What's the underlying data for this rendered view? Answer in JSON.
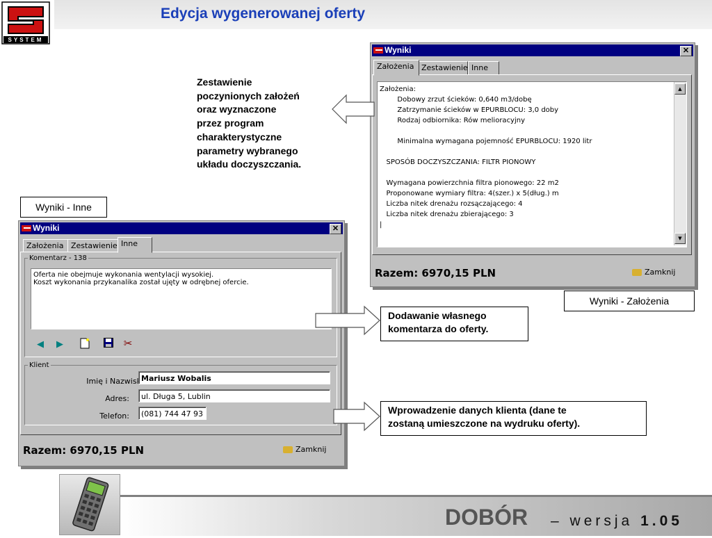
{
  "slide": {
    "title": "Edycja wygenerowanej oferty",
    "logo_text": "SYSTEM"
  },
  "window_zalozenia": {
    "title": "Wyniki",
    "close_glyph": "✕",
    "tabs": [
      "Założenia",
      "Zestawienie",
      "Inne"
    ],
    "active_tab": "Założenia",
    "content_lines": [
      "Założenia:",
      "        Dobowy zrzut ścieków: 0,640 m3/dobę",
      "        Zatrzymanie ścieków w EPURBLOCU: 3,0 doby",
      "        Rodzaj odbiornika: Rów melioracyjny",
      "",
      "        Minimalna wymagana pojemność EPURBLOCU: 1920 litr",
      "",
      "   SPOSÓB DOCZYSZCZANIA: FILTR PIONOWY",
      "",
      "   Wymagana powierzchnia filtra pionowego: 22 m2",
      "   Proponowane wymiary filtra: 4(szer.) x 5(dług.) m",
      "   Liczba nitek drenażu rozsączającego: 4",
      "   Liczba nitek drenażu zbierającego: 3",
      "|"
    ],
    "total": "Razem: 6970,15 PLN",
    "close_button": "Zamknij",
    "caption": "Wyniki - Założenia"
  },
  "window_inne": {
    "title": "Wyniki",
    "close_glyph": "✕",
    "tabs": [
      "Założenia",
      "Zestawienie",
      "Inne"
    ],
    "active_tab": "Inne",
    "comment_group": "Komentarz - 138",
    "comment_lines": [
      "Oferta nie obejmuje wykonania wentylacji wysokiej.",
      "Koszt wykonania przykanalika został ujęty w odrębnej ofercie."
    ],
    "toolbar_icons": [
      "arrow-left-icon",
      "arrow-right-icon",
      "new-document-icon",
      "save-icon",
      "scissors-icon"
    ],
    "client_group": "Klient",
    "client": {
      "name_label": "Imię i Nazwisko:",
      "name_value": "Mariusz Wobalis",
      "address_label": "Adres:",
      "address_value": "ul. Długa 5, Lublin",
      "phone_label": "Telefon:",
      "phone_value": "(081) 744 47 93"
    },
    "total": "Razem: 6970,15 PLN",
    "close_button": "Zamknij",
    "caption": "Wyniki - Inne"
  },
  "callouts": {
    "zalozenia_lines": [
      "Zestawienie",
      "poczynionych założeń",
      "oraz wyznaczone",
      "przez program",
      "charakterystyczne",
      "parametry wybranego",
      "układu doczyszczania."
    ],
    "comment_lines": [
      "Dodawanie własnego",
      "komentarza do oferty."
    ],
    "client_lines": [
      "Wprowadzenie danych klienta (dane te",
      "zostaną umieszczone na wydruku oferty)."
    ]
  },
  "footer": {
    "brand": "DOBÓR",
    "dash": "–",
    "version_word": "wersja",
    "version_number": "1.05"
  },
  "colors": {
    "title_blue": "#1a3fb8",
    "titlebar_navy": "#000080",
    "window_gray": "#c0c0c0",
    "logo_red": "#cc1111"
  }
}
